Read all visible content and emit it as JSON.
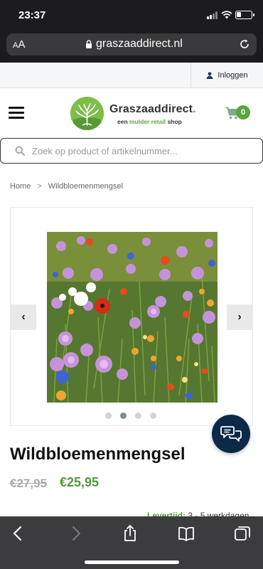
{
  "status_bar": {
    "time": "23:37"
  },
  "browser": {
    "text_size": "AA",
    "host": "graszaaddirect.nl"
  },
  "site": {
    "login_label": "Inloggen",
    "logo": {
      "name": "Graszaaddirect",
      "name_dot": ".",
      "tagline_prefix": "een",
      "tagline_brand": "mulder retail",
      "tagline_suffix": "shop"
    },
    "cart_count": "0",
    "search_placeholder": "Zoek op product of artikelnummer..."
  },
  "breadcrumb": {
    "home": "Home",
    "separator": ">",
    "current": "Wildbloemenmengsel"
  },
  "gallery": {
    "prev": "‹",
    "next": "›",
    "slide_count": 4,
    "active_slide": 2
  },
  "product": {
    "title": "Wildbloemenmengsel",
    "old_price": "€27,95",
    "new_price": "€25,95",
    "delivery_label": "Levertijd:",
    "delivery_value": "3 - 5 werkdagen"
  },
  "colors": {
    "brand_green": "#5aa63d",
    "chat_navy": "#0c2a47",
    "price_green": "#4f9a3b"
  }
}
